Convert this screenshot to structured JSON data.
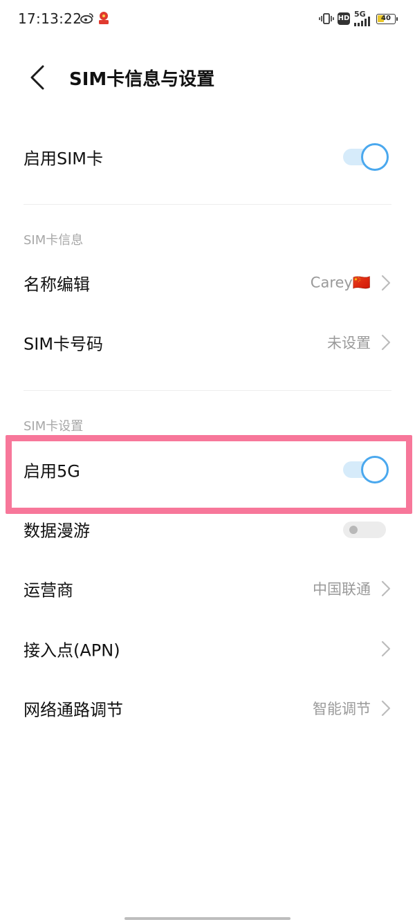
{
  "status_bar": {
    "time": "17:13:22",
    "network": "5G",
    "hd": "HD",
    "battery": "40"
  },
  "header": {
    "title": "SIM卡信息与设置"
  },
  "rows": {
    "enable_sim": {
      "label": "启用SIM卡",
      "on": true
    },
    "name_edit": {
      "label": "名称编辑",
      "value": "Carey🇨🇳"
    },
    "sim_number": {
      "label": "SIM卡号码",
      "value": "未设置"
    },
    "enable_5g": {
      "label": "启用5G",
      "on": true
    },
    "data_roaming": {
      "label": "数据漫游",
      "on": false
    },
    "carrier": {
      "label": "运营商",
      "value": "中国联通"
    },
    "apn": {
      "label": "接入点(APN)"
    },
    "network_tuning": {
      "label": "网络通路调节",
      "value": "智能调节"
    }
  },
  "sections": {
    "sim_info": "SIM卡信息",
    "sim_settings": "SIM卡设置"
  },
  "colors": {
    "accent": "#4aa8ee",
    "highlight": "#f7779a"
  }
}
